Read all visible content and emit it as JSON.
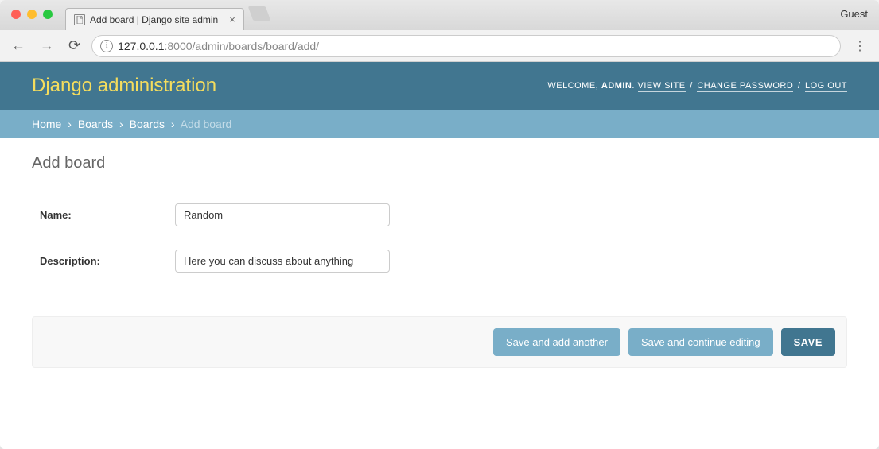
{
  "browser": {
    "tab_title": "Add board | Django site admin",
    "guest_label": "Guest",
    "url_host": "127.0.0.1",
    "url_port_path": ":8000/admin/boards/board/add/"
  },
  "header": {
    "branding": "Django administration",
    "welcome": "WELCOME,",
    "username": "ADMIN",
    "view_site": "VIEW SITE",
    "change_password": "CHANGE PASSWORD",
    "logout": "LOG OUT"
  },
  "breadcrumbs": {
    "home": "Home",
    "app": "Boards",
    "model": "Boards",
    "current": "Add board"
  },
  "content": {
    "title": "Add board",
    "fields": {
      "name_label": "Name:",
      "name_value": "Random",
      "description_label": "Description:",
      "description_value": "Here you can discuss about anything"
    },
    "buttons": {
      "save_add_another": "Save and add another",
      "save_continue": "Save and continue editing",
      "save": "SAVE"
    }
  }
}
